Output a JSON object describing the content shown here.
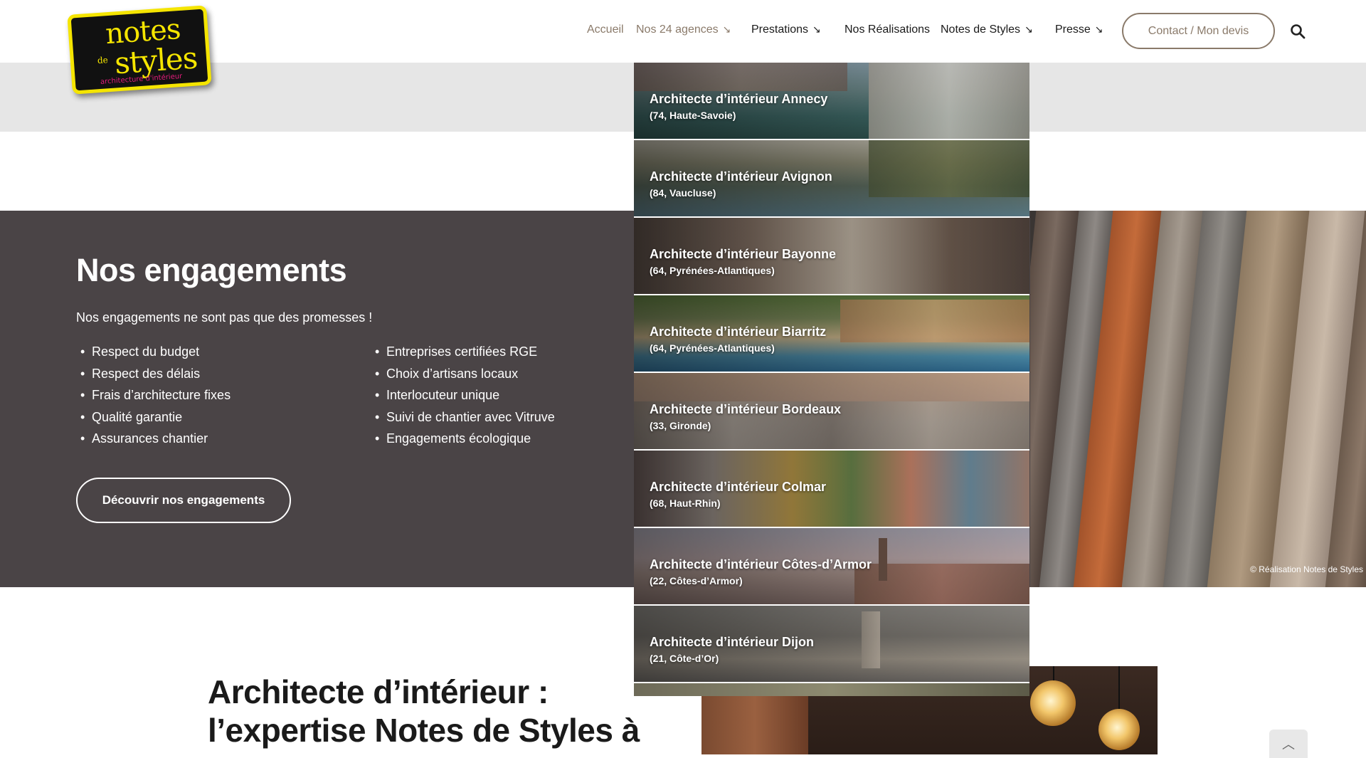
{
  "logo": {
    "line1": "notes",
    "line2": "de",
    "line3": "styles",
    "tagline": "architecture d'intérieur"
  },
  "nav": {
    "items": [
      {
        "label": "Accueil",
        "arrow": ""
      },
      {
        "label": "Nos 24 agences",
        "arrow": "↘"
      },
      {
        "label": "Prestations",
        "arrow": "↘"
      },
      {
        "label": "Nos Réalisations",
        "arrow": ""
      },
      {
        "label": "Notes de Styles",
        "arrow": "↘"
      },
      {
        "label": "Presse",
        "arrow": "↘"
      }
    ],
    "contact_label": "Contact / Mon devis",
    "search_icon": "search-icon"
  },
  "dropdown": {
    "items": [
      {
        "title": "Architecte d’intérieur Annecy",
        "sub": "(74, Haute-Savoie)"
      },
      {
        "title": "Architecte d’intérieur Avignon",
        "sub": "(84, Vaucluse)"
      },
      {
        "title": "Architecte d’intérieur Bayonne",
        "sub": "(64, Pyrénées-Atlantiques)"
      },
      {
        "title": "Architecte d’intérieur Biarritz",
        "sub": "(64, Pyrénées-Atlantiques)"
      },
      {
        "title": "Architecte d’intérieur Bordeaux",
        "sub": "(33, Gironde)"
      },
      {
        "title": "Architecte d’intérieur Colmar",
        "sub": "(68, Haut-Rhin)"
      },
      {
        "title": "Architecte d’intérieur Côtes-d’Armor",
        "sub": "(22, Côtes-d’Armor)"
      },
      {
        "title": "Architecte d’intérieur Dijon",
        "sub": "(21, Côte-d’Or)"
      }
    ]
  },
  "engagements": {
    "title": "Nos engagements",
    "intro": "Nos engagements ne sont pas que des promesses !",
    "col1": [
      "Respect du budget",
      "Respect des délais",
      "Frais d’architecture fixes",
      "Qualité garantie",
      "Assurances chantier"
    ],
    "col2": [
      "Entreprises certifiées RGE",
      "Choix d’artisans locaux",
      "Interlocuteur unique",
      "Suivi de chantier avec Vitruve",
      "Engagements écologique"
    ],
    "cta": "Découvrir nos engagements",
    "photo_credit": "© Réalisation Notes de Styles"
  },
  "bottom": {
    "title_line1": "Architecte d’intérieur :",
    "title_line2": "l’expertise Notes de Styles à"
  },
  "scroll_top": "︿"
}
